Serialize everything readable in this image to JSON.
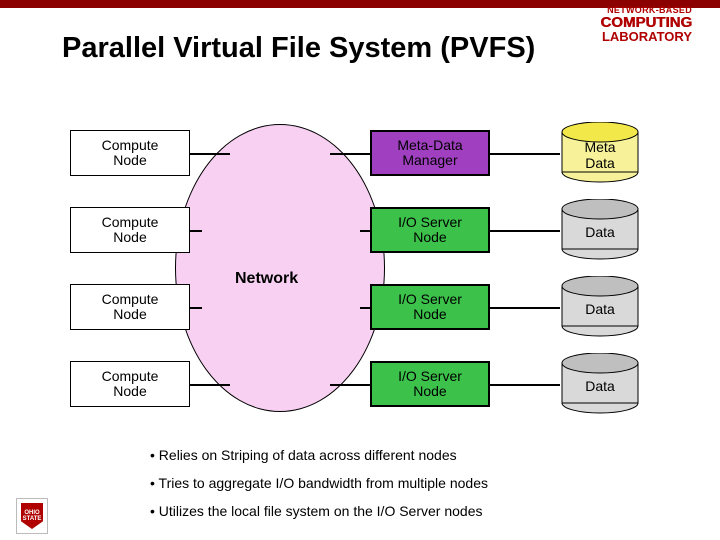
{
  "lab_logo": {
    "line1": "NETWORK-BASED",
    "line2": "COMPUTING",
    "line3": "LABORATORY"
  },
  "title": "Parallel Virtual File System (PVFS)",
  "compute_nodes": [
    "Compute\nNode",
    "Compute\nNode",
    "Compute\nNode",
    "Compute\nNode"
  ],
  "network_label": "Network",
  "servers": {
    "metadata": "Meta-Data\nManager",
    "ios": [
      "I/O Server\nNode",
      "I/O Server\nNode",
      "I/O Server\nNode"
    ]
  },
  "cylinders": {
    "meta": "Meta\nData",
    "data": [
      "Data",
      "Data",
      "Data"
    ]
  },
  "bullets": [
    "Relies on Striping of data across different nodes",
    "Tries to aggregate I/O bandwidth from multiple nodes",
    "Utilizes the local file system on the I/O Server nodes"
  ],
  "osu_text": "OHIO\nSTATE",
  "colors": {
    "meta_cyl_top": "#f2e84a",
    "meta_cyl_body": "#f7f29a",
    "data_cyl": "#d9d9d9",
    "data_cyl_top": "#bfbfbf"
  }
}
